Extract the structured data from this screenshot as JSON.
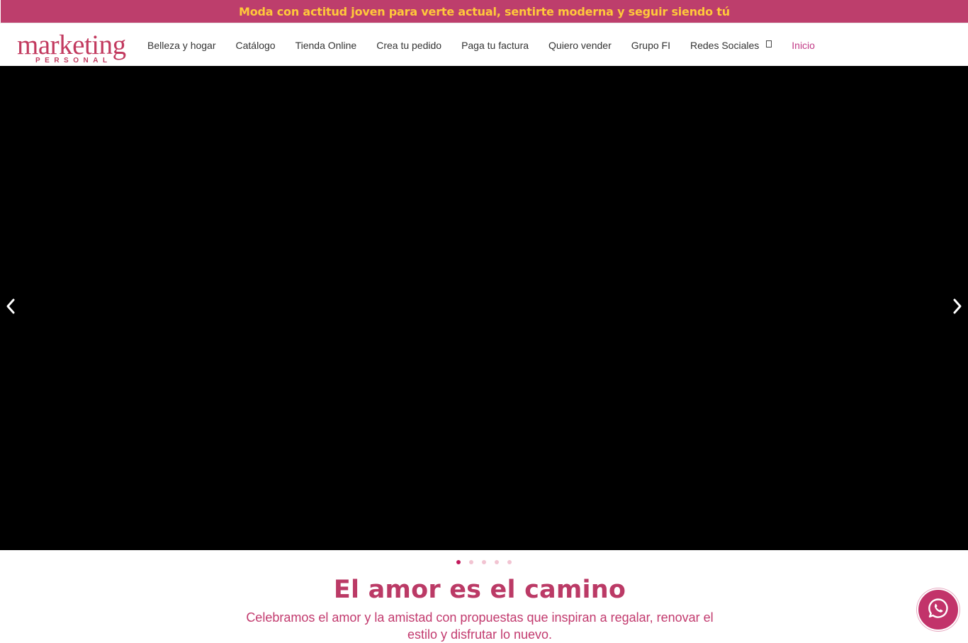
{
  "promo": {
    "text": "Moda con actitud joven para verte actual, sentirte moderna y seguir siendo tú"
  },
  "logo": {
    "main": "marketing",
    "sub": "PERSONAL"
  },
  "nav": {
    "items": [
      {
        "label": "Belleza y hogar"
      },
      {
        "label": "Catálogo"
      },
      {
        "label": "Tienda Online"
      },
      {
        "label": "Crea tu pedido"
      },
      {
        "label": "Paga tu factura"
      },
      {
        "label": "Quiero vender"
      },
      {
        "label": "Grupo FI"
      },
      {
        "label": "Redes Sociales",
        "dropdown": true
      },
      {
        "label": "Inicio",
        "active": true
      }
    ]
  },
  "slider": {
    "slide_count": 5,
    "active_index": 0,
    "prev_icon": "chevron-left-icon",
    "next_icon": "chevron-right-icon"
  },
  "content": {
    "headline": "El amor es el camino",
    "subtext": "Celebramos el amor y la amistad con propuestas que inspiran a regalar, renovar el estilo y disfrutar lo nuevo."
  },
  "whatsapp": {
    "icon": "whatsapp-icon"
  },
  "colors": {
    "brand": "#bd3e6c",
    "promo_text": "#ffc93a",
    "nav_active": "#c23a86",
    "dot_active": "#c2185b",
    "dot_inactive": "#f2c4d2"
  }
}
